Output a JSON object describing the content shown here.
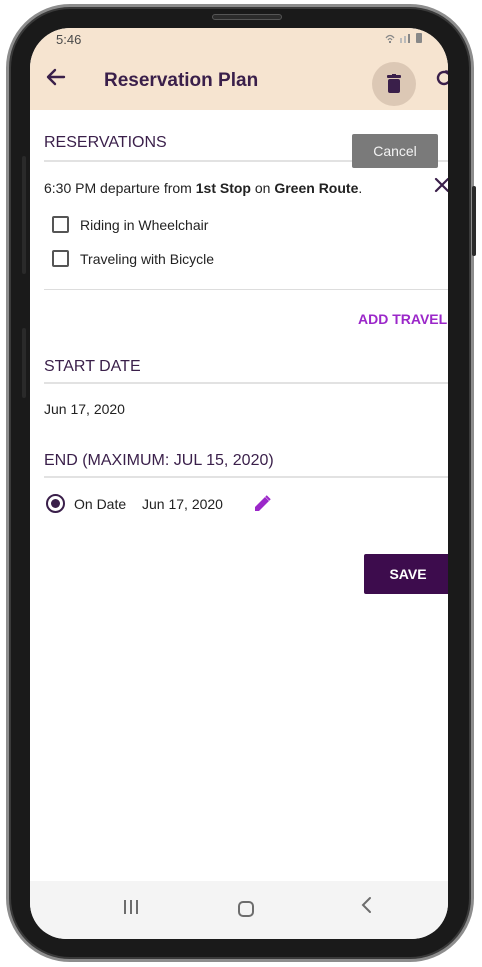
{
  "status": {
    "time": "5:46",
    "icons": "wifi-signal-battery"
  },
  "appbar": {
    "title": "Reservation Plan",
    "back_icon": "back-arrow-icon",
    "delete_icon": "trash-icon",
    "refresh_icon": "refresh-icon"
  },
  "reservations": {
    "header": "RESERVATIONS",
    "tooltip": "Cancel",
    "trip": {
      "prefix": "6:30 PM departure from ",
      "stop": "1st Stop",
      "mid": " on ",
      "route": "Green Route",
      "suffix": "."
    },
    "options": [
      {
        "label": "Riding in Wheelchair",
        "checked": false
      },
      {
        "label": "Traveling with Bicycle",
        "checked": false
      }
    ],
    "add_travel": "ADD TRAVEL"
  },
  "start_date": {
    "header": "START DATE",
    "value": "Jun 17, 2020"
  },
  "end": {
    "header": "END (MAXIMUM: JUL 15, 2020)",
    "option_label": "On Date",
    "date": "Jun 17, 2020",
    "selected": true
  },
  "save_label": "SAVE",
  "colors": {
    "appbar": "#f6e4d0",
    "primary": "#3d0c4d",
    "accent": "#9b27c9",
    "tooltip": "#7a7a7a"
  },
  "nav": {
    "recents_icon": "recents-icon",
    "home_icon": "home-icon",
    "back_icon": "back-chevron-icon"
  }
}
